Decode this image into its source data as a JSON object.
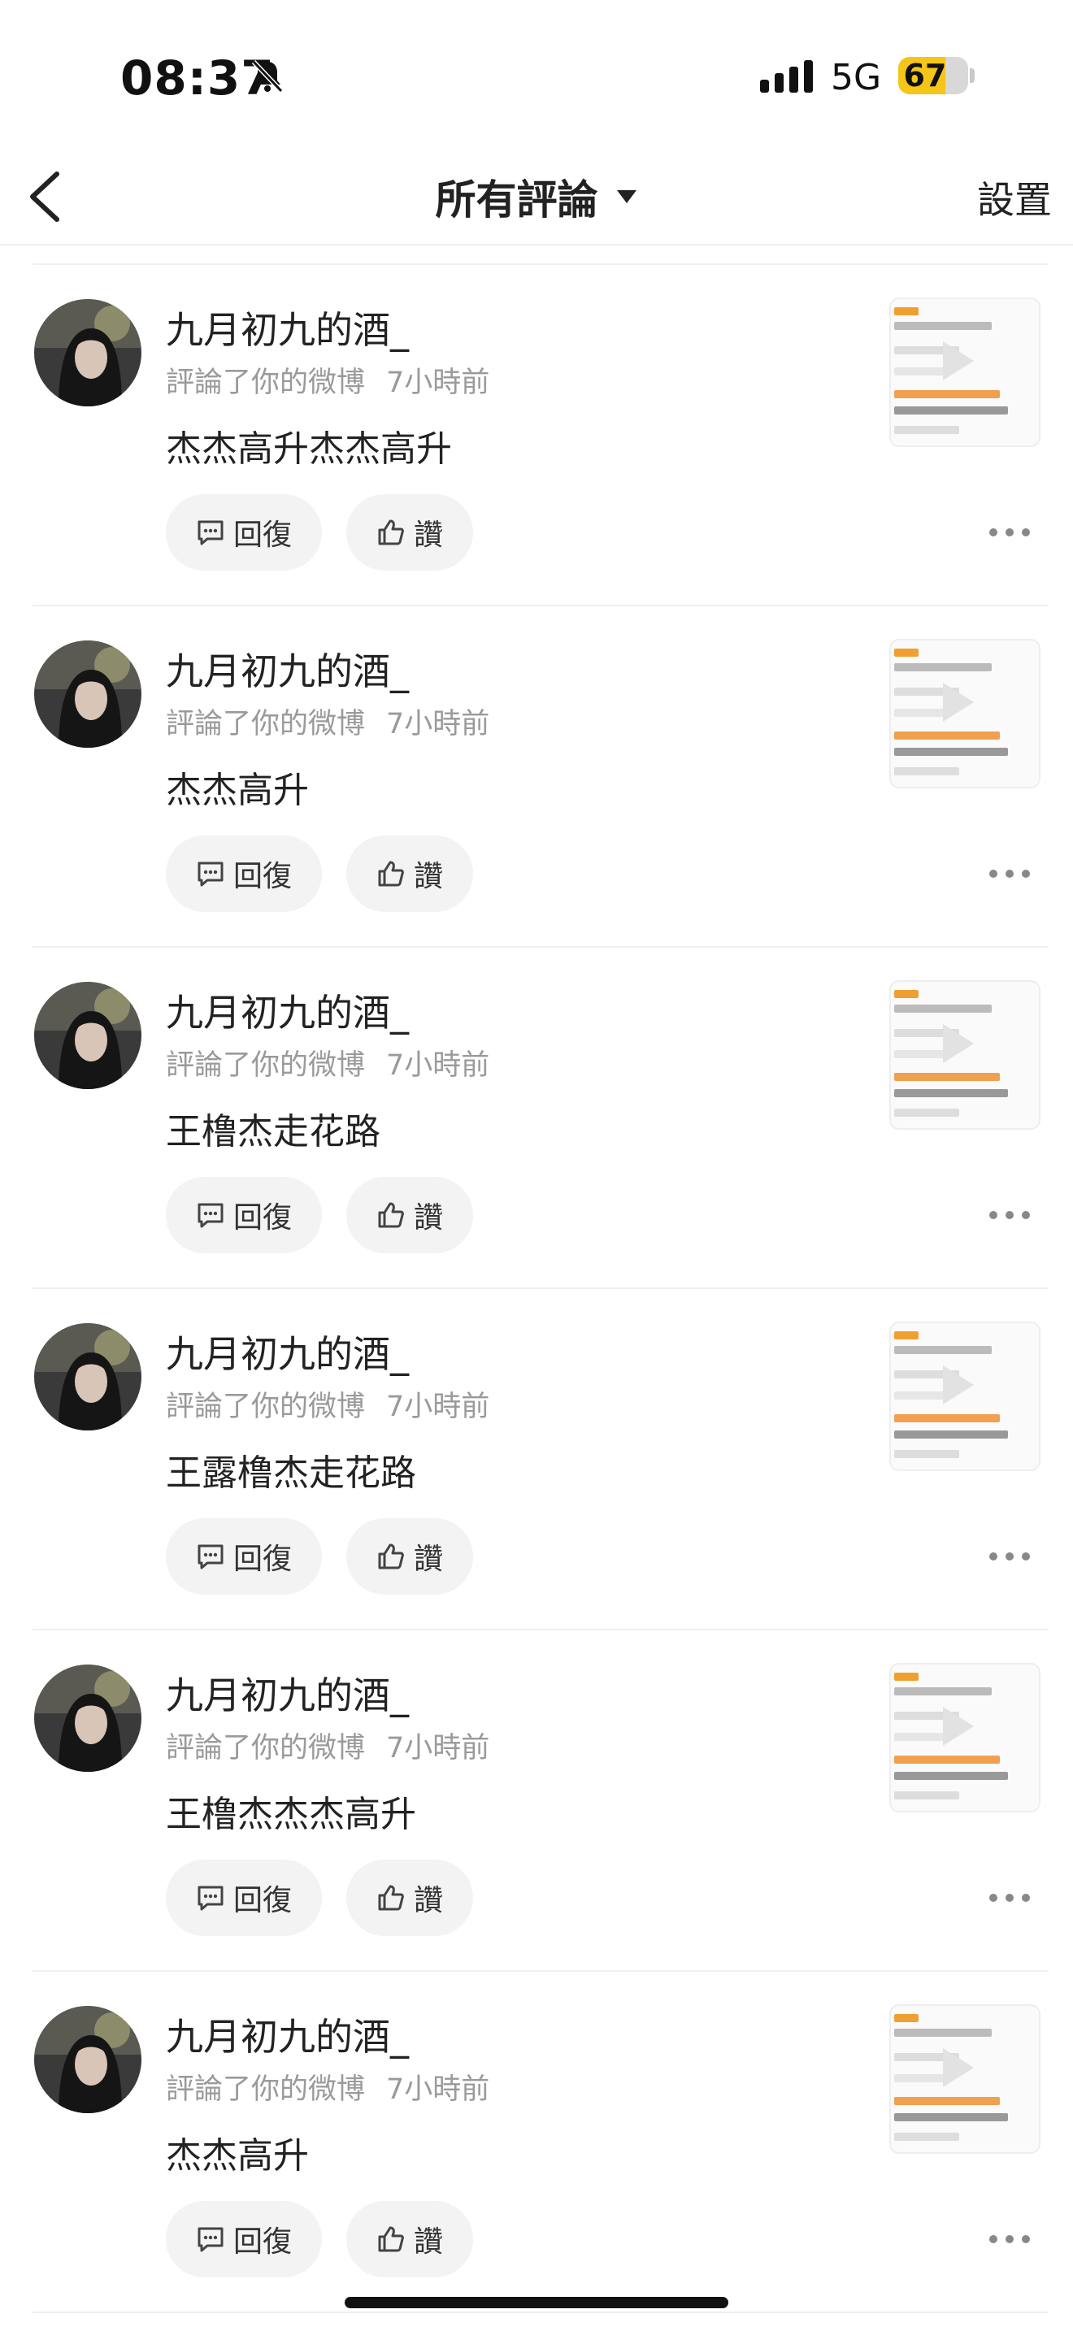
{
  "status_bar": {
    "time": "08:37",
    "network": "5G",
    "battery": "67",
    "battery_level": 0.67
  },
  "header": {
    "title": "所有評論",
    "settings_label": "設置"
  },
  "colors": {
    "accent": "#f5c518",
    "meta_text": "#9a9a9a",
    "button_bg": "#f3f3f3"
  },
  "comments": [
    {
      "user": "九月初九的酒_",
      "action": "評論了你的微博",
      "time": "7小時前",
      "text": "杰杰高升杰杰高升",
      "reply_label": "回復",
      "like_label": "讚"
    },
    {
      "user": "九月初九的酒_",
      "action": "評論了你的微博",
      "time": "7小時前",
      "text": "杰杰高升",
      "reply_label": "回復",
      "like_label": "讚"
    },
    {
      "user": "九月初九的酒_",
      "action": "評論了你的微博",
      "time": "7小時前",
      "text": "王橹杰走花路",
      "reply_label": "回復",
      "like_label": "讚"
    },
    {
      "user": "九月初九的酒_",
      "action": "評論了你的微博",
      "time": "7小時前",
      "text": "王露橹杰走花路",
      "reply_label": "回復",
      "like_label": "讚"
    },
    {
      "user": "九月初九的酒_",
      "action": "評論了你的微博",
      "time": "7小時前",
      "text": "王橹杰杰杰高升",
      "reply_label": "回復",
      "like_label": "讚"
    },
    {
      "user": "九月初九的酒_",
      "action": "評論了你的微博",
      "time": "7小時前",
      "text": "杰杰高升",
      "reply_label": "回復",
      "like_label": "讚"
    }
  ]
}
